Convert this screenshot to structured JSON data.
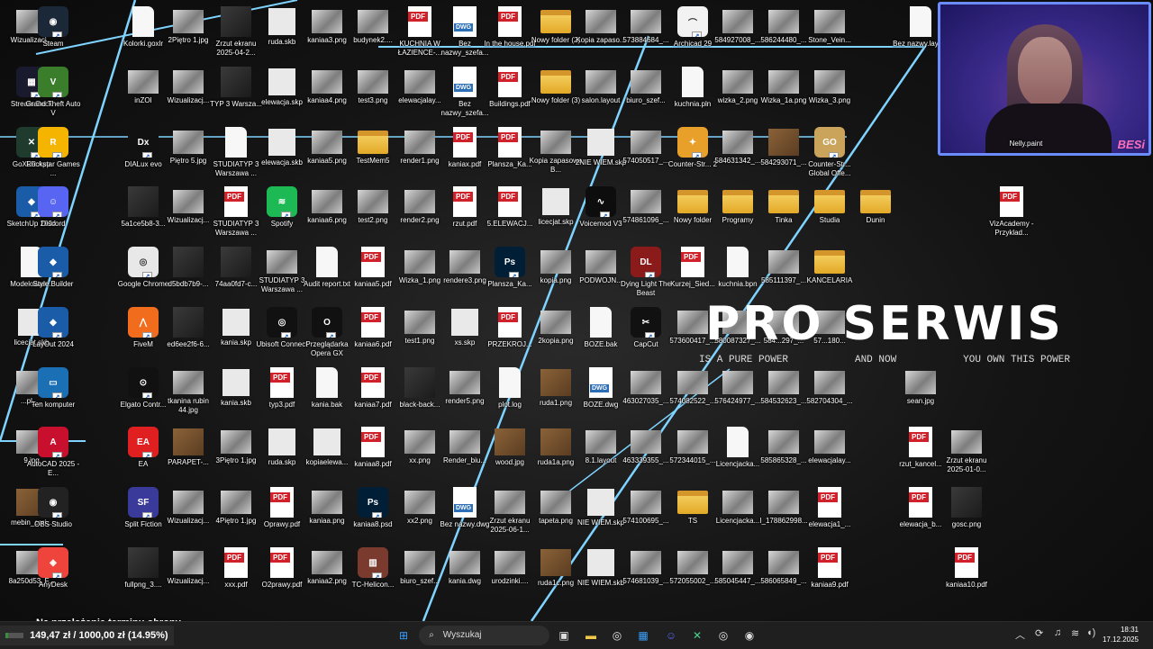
{
  "desktop": {
    "icons": [
      {
        "label": "Wizualizacj...",
        "kind": "img"
      },
      {
        "label": "Steam",
        "kind": "app",
        "color": "#1b2838",
        "glyph": "◉"
      },
      {
        "label": "Kolorki.goxlr",
        "kind": "doc"
      },
      {
        "label": "2Piętro 1.jpg",
        "kind": "img"
      },
      {
        "label": "Zrzut ekranu 2025-04-2...",
        "kind": "dark"
      },
      {
        "label": "ruda.skb",
        "kind": "sketch"
      },
      {
        "label": "kaniaa3.png",
        "kind": "img"
      },
      {
        "label": "budynek2....",
        "kind": "img"
      },
      {
        "label": "KUCHNIA W ŁAZIENCE-...",
        "kind": "pdf"
      },
      {
        "label": "Bez nazwy_szefa...",
        "kind": "dwg"
      },
      {
        "label": "In the house.pdf",
        "kind": "pdf"
      },
      {
        "label": "Nowy folder (2)",
        "kind": "folder"
      },
      {
        "label": "Kopia zapaso...",
        "kind": "img"
      },
      {
        "label": "573884684_...",
        "kind": "img"
      },
      {
        "label": "Archicad 29",
        "kind": "app",
        "color": "#f2f2f2",
        "glyph": "⌒"
      },
      {
        "label": "584927008_...",
        "kind": "img"
      },
      {
        "label": "586244480_...",
        "kind": "img"
      },
      {
        "label": "Stone_Vein...",
        "kind": "img"
      },
      {
        "label": "Bez nazwy.layout",
        "kind": "doc"
      },
      {
        "label": "Stream Deck",
        "kind": "app",
        "color": "#1a1a2e",
        "glyph": "▦"
      },
      {
        "label": "Grand Theft Auto V",
        "kind": "app",
        "color": "#3a7d2a",
        "glyph": "V"
      },
      {
        "label": "inZOI",
        "kind": "img"
      },
      {
        "label": "Wizualizacj...",
        "kind": "img"
      },
      {
        "label": "TYP 3 Warsza...",
        "kind": "dark"
      },
      {
        "label": "elewacja.skp",
        "kind": "sketch"
      },
      {
        "label": "kaniaa4.png",
        "kind": "img"
      },
      {
        "label": "test3.png",
        "kind": "img"
      },
      {
        "label": "elewacjalay...",
        "kind": "img"
      },
      {
        "label": "Bez nazwy_szefa...",
        "kind": "dwg"
      },
      {
        "label": "Buildings.pdf",
        "kind": "pdf"
      },
      {
        "label": "Nowy folder (3)",
        "kind": "folder"
      },
      {
        "label": "salon.layout",
        "kind": "img"
      },
      {
        "label": "biuro_szef...",
        "kind": "img"
      },
      {
        "label": "kuchnia.pln",
        "kind": "doc"
      },
      {
        "label": "wizka_2.png",
        "kind": "img"
      },
      {
        "label": "Wizka_1a.png",
        "kind": "img"
      },
      {
        "label": "Wizka_3.png",
        "kind": "img"
      },
      {
        "label": "GoXLR App",
        "kind": "app",
        "color": "#1f3b2e",
        "glyph": "✕"
      },
      {
        "label": "Rockstar Games ...",
        "kind": "app",
        "color": "#f5b400",
        "glyph": "R"
      },
      {
        "label": "DIALux evo",
        "kind": "app",
        "color": "#111",
        "glyph": "Dx"
      },
      {
        "label": "Piętro 5.jpg",
        "kind": "img"
      },
      {
        "label": "STUDIATYP 3 Warszawa ...",
        "kind": "doc"
      },
      {
        "label": "elewacja.skb",
        "kind": "sketch"
      },
      {
        "label": "kaniaa5.png",
        "kind": "img"
      },
      {
        "label": "TestMem5",
        "kind": "folder"
      },
      {
        "label": "render1.png",
        "kind": "img"
      },
      {
        "label": "kaniax.pdf",
        "kind": "pdf"
      },
      {
        "label": "Plansza_Ka...",
        "kind": "pdf"
      },
      {
        "label": "Kopia zapasowa B...",
        "kind": "img"
      },
      {
        "label": "2NIE WIEM.skp",
        "kind": "sketch"
      },
      {
        "label": "574050517_...",
        "kind": "img"
      },
      {
        "label": "Counter-Str... 2",
        "kind": "app",
        "color": "#e8a02a",
        "glyph": "✦"
      },
      {
        "label": "584631342_...",
        "kind": "img"
      },
      {
        "label": "584293071_...",
        "kind": "wood"
      },
      {
        "label": "Counter-Str... Global Offe...",
        "kind": "app",
        "color": "#c9a45a",
        "glyph": "GO"
      },
      {
        "label": "SketchUp 2024",
        "kind": "app",
        "color": "#1a5ca8",
        "glyph": "◆"
      },
      {
        "label": "Discord",
        "kind": "app",
        "color": "#5865f2",
        "glyph": "☺"
      },
      {
        "label": "5a1ce5b8-3...",
        "kind": "dark"
      },
      {
        "label": "Wizualizacj...",
        "kind": "img"
      },
      {
        "label": "STUDIATYP 3 Warszawa ...",
        "kind": "pdf"
      },
      {
        "label": "Spotify",
        "kind": "app",
        "color": "#1db954",
        "glyph": "≋"
      },
      {
        "label": "kaniaa6.png",
        "kind": "img"
      },
      {
        "label": "test2.png",
        "kind": "img"
      },
      {
        "label": "render2.png",
        "kind": "img"
      },
      {
        "label": "rzut.pdf",
        "kind": "pdf"
      },
      {
        "label": "5.ELEWACJ...",
        "kind": "pdf"
      },
      {
        "label": "licecjat.skp",
        "kind": "sketch"
      },
      {
        "label": "Voicemod V3",
        "kind": "app",
        "color": "#0d0d0d",
        "glyph": "∿"
      },
      {
        "label": "574861096_...",
        "kind": "img"
      },
      {
        "label": "Nowy folder",
        "kind": "folder"
      },
      {
        "label": "Programy",
        "kind": "folder"
      },
      {
        "label": "Tinka",
        "kind": "folder"
      },
      {
        "label": "Studia",
        "kind": "folder"
      },
      {
        "label": "Dunin",
        "kind": "folder"
      },
      {
        "label": "VizAcademy - Przyklad...",
        "kind": "pdf"
      },
      {
        "label": "Modelowan...",
        "kind": "doc"
      },
      {
        "label": "Style Builder",
        "kind": "app",
        "color": "#1a5ca8",
        "glyph": "◆"
      },
      {
        "label": "Google Chrome",
        "kind": "app",
        "color": "#e8e8e8",
        "glyph": "◎"
      },
      {
        "label": "d5bdb7b9-...",
        "kind": "dark"
      },
      {
        "label": "74aa0fd7-c...",
        "kind": "dark"
      },
      {
        "label": "STUDIATYP 3 Warszawa ...",
        "kind": "img"
      },
      {
        "label": "Audit report.txt",
        "kind": "doc"
      },
      {
        "label": "kaniaa5.pdf",
        "kind": "pdf"
      },
      {
        "label": "Wizka_1.png",
        "kind": "img"
      },
      {
        "label": "rendere3.png",
        "kind": "img"
      },
      {
        "label": "Plansza_Ka...",
        "kind": "app",
        "color": "#001e36",
        "glyph": "Ps"
      },
      {
        "label": "kopia.png",
        "kind": "img"
      },
      {
        "label": "PODWOJN...",
        "kind": "img"
      },
      {
        "label": "Dying Light The Beast",
        "kind": "app",
        "color": "#8b1a1a",
        "glyph": "DL"
      },
      {
        "label": "Kurzej_Sied...",
        "kind": "pdf"
      },
      {
        "label": "kuchnia.bpn",
        "kind": "doc"
      },
      {
        "label": "585111397_...",
        "kind": "img"
      },
      {
        "label": "KANCELARIA",
        "kind": "folder"
      },
      {
        "label": "licecjat.skb",
        "kind": "sketch"
      },
      {
        "label": "LayOut 2024",
        "kind": "app",
        "color": "#1a5ca8",
        "glyph": "◆"
      },
      {
        "label": "FiveM",
        "kind": "app",
        "color": "#f26c1d",
        "glyph": "⋀"
      },
      {
        "label": "ed6ee2f6-6...",
        "kind": "dark"
      },
      {
        "label": "kania.skp",
        "kind": "sketch"
      },
      {
        "label": "Ubisoft Connect",
        "kind": "app",
        "color": "#111",
        "glyph": "◎"
      },
      {
        "label": "Przeglądarka Opera GX",
        "kind": "app",
        "color": "#111",
        "glyph": "O"
      },
      {
        "label": "kaniaa6.pdf",
        "kind": "pdf"
      },
      {
        "label": "test1.png",
        "kind": "img"
      },
      {
        "label": "xs.skp",
        "kind": "sketch"
      },
      {
        "label": "PRZEKROJ...",
        "kind": "pdf"
      },
      {
        "label": "2kopia.png",
        "kind": "img"
      },
      {
        "label": "BOZE.bak",
        "kind": "doc"
      },
      {
        "label": "CapCut",
        "kind": "app",
        "color": "#111",
        "glyph": "✂"
      },
      {
        "label": "573600417_...",
        "kind": "img"
      },
      {
        "label": "580087327_...",
        "kind": "img"
      },
      {
        "label": "584...297_...",
        "kind": "img"
      },
      {
        "label": "57...180...",
        "kind": "img"
      },
      {
        "label": "...pl_...",
        "kind": "img"
      },
      {
        "label": "Ten komputer",
        "kind": "app",
        "color": "#1b6fb5",
        "glyph": "▭"
      },
      {
        "label": "Elgato Contr...",
        "kind": "app",
        "color": "#111",
        "glyph": "⊙"
      },
      {
        "label": "tkanina rubin 44.jpg",
        "kind": "img"
      },
      {
        "label": "kania.skb",
        "kind": "sketch"
      },
      {
        "label": "typ3.pdf",
        "kind": "pdf"
      },
      {
        "label": "kania.bak",
        "kind": "doc"
      },
      {
        "label": "kaniaa7.pdf",
        "kind": "pdf"
      },
      {
        "label": "black-back...",
        "kind": "dark"
      },
      {
        "label": "render5.png",
        "kind": "img"
      },
      {
        "label": "plot.log",
        "kind": "doc"
      },
      {
        "label": "ruda1.png",
        "kind": "wood"
      },
      {
        "label": "BOZE.dwg",
        "kind": "dwg"
      },
      {
        "label": "463027035_...",
        "kind": "img"
      },
      {
        "label": "574082522_...",
        "kind": "img"
      },
      {
        "label": "576424977_...",
        "kind": "img"
      },
      {
        "label": "584532623_...",
        "kind": "img"
      },
      {
        "label": "582704304_...",
        "kind": "img"
      },
      {
        "label": "sean.jpg",
        "kind": "img"
      },
      {
        "label": "9.jpg",
        "kind": "img"
      },
      {
        "label": "AutoCAD 2025 - E...",
        "kind": "app",
        "color": "#c8102e",
        "glyph": "A"
      },
      {
        "label": "EA",
        "kind": "app",
        "color": "#e02020",
        "glyph": "EA"
      },
      {
        "label": "PARAPET-...",
        "kind": "wood"
      },
      {
        "label": "3Piętro 1.jpg",
        "kind": "img"
      },
      {
        "label": "ruda.skp",
        "kind": "sketch"
      },
      {
        "label": "kopiaelewa...",
        "kind": "sketch"
      },
      {
        "label": "kaniaa8.pdf",
        "kind": "pdf"
      },
      {
        "label": "xx.png",
        "kind": "img"
      },
      {
        "label": "Render_biu...",
        "kind": "img"
      },
      {
        "label": "wood.jpg",
        "kind": "wood"
      },
      {
        "label": "ruda1a.png",
        "kind": "wood"
      },
      {
        "label": "8.1.layout",
        "kind": "img"
      },
      {
        "label": "463339355_...",
        "kind": "img"
      },
      {
        "label": "572344015_...",
        "kind": "img"
      },
      {
        "label": "Licencjacka...",
        "kind": "doc"
      },
      {
        "label": "585865328_...",
        "kind": "img"
      },
      {
        "label": "elewacjalay...",
        "kind": "img"
      },
      {
        "label": "rzut_kancel...",
        "kind": "pdf"
      },
      {
        "label": "Zrzut ekranu 2025-01-0...",
        "kind": "img"
      },
      {
        "label": "mebin_cori...",
        "kind": "wood"
      },
      {
        "label": "OBS Studio",
        "kind": "app",
        "color": "#222",
        "glyph": "◉"
      },
      {
        "label": "Split Fiction",
        "kind": "app",
        "color": "#3a3a9a",
        "glyph": "SF"
      },
      {
        "label": "Wizualizacj...",
        "kind": "img"
      },
      {
        "label": "4Piętro 1.jpg",
        "kind": "img"
      },
      {
        "label": "Oprawy.pdf",
        "kind": "pdf"
      },
      {
        "label": "kaniaa.png",
        "kind": "img"
      },
      {
        "label": "kaniaa8.psd",
        "kind": "app",
        "color": "#001e36",
        "glyph": "Ps"
      },
      {
        "label": "xx2.png",
        "kind": "img"
      },
      {
        "label": "Bez nazwy.dwg",
        "kind": "dwg"
      },
      {
        "label": "Zrzut ekranu 2025-06-1...",
        "kind": "img"
      },
      {
        "label": "tapeta.png",
        "kind": "img"
      },
      {
        "label": "NIE WIEM.skp",
        "kind": "sketch"
      },
      {
        "label": "574100695_...",
        "kind": "img"
      },
      {
        "label": "TS",
        "kind": "folder"
      },
      {
        "label": "Licencjacka...",
        "kind": "img"
      },
      {
        "label": "I_178862998...",
        "kind": "img"
      },
      {
        "label": "elewacja1_...",
        "kind": "pdf"
      },
      {
        "label": "elewacja_b...",
        "kind": "pdf"
      },
      {
        "label": "gosc.png",
        "kind": "dark"
      },
      {
        "label": "8a250d53_F...",
        "kind": "img"
      },
      {
        "label": "AnyDesk",
        "kind": "app",
        "color": "#ef443b",
        "glyph": "◈"
      },
      {
        "label": "fullpng_3....",
        "kind": "dark"
      },
      {
        "label": "Wizualizacj...",
        "kind": "img"
      },
      {
        "label": "xxx.pdf",
        "kind": "pdf"
      },
      {
        "label": "O2prawy.pdf",
        "kind": "pdf"
      },
      {
        "label": "kaniaa2.png",
        "kind": "img"
      },
      {
        "label": "TC-Helicon...",
        "kind": "app",
        "color": "#7a3b2e",
        "glyph": "▥"
      },
      {
        "label": "biuro_szef...",
        "kind": "img"
      },
      {
        "label": "kania.dwg",
        "kind": "img"
      },
      {
        "label": "urodzinki....",
        "kind": "img"
      },
      {
        "label": "ruda1c.png",
        "kind": "wood"
      },
      {
        "label": "NIE WIEM.skb",
        "kind": "sketch"
      },
      {
        "label": "574681039_...",
        "kind": "img"
      },
      {
        "label": "572055002_...",
        "kind": "img"
      },
      {
        "label": "585045447_...",
        "kind": "img"
      },
      {
        "label": "586065849_...",
        "kind": "img"
      },
      {
        "label": "kaniaa9.pdf",
        "kind": "pdf"
      },
      {
        "label": "kaniaa10.pdf",
        "kind": "pdf"
      },
      {
        "label": "ko0ipa.jpg",
        "kind": "img"
      }
    ],
    "webcam": {
      "tag": "BESi",
      "label": "Nelly.paint"
    }
  },
  "banner": {
    "title": "PRO SERWIS",
    "sub1": "IS A PURE POWER",
    "sub2": "AND NOW",
    "sub3": "YOU OWN THIS POWER"
  },
  "notification": "Na przełożenie terminu obrony",
  "taskbar": {
    "budget": "149,47 zł / 1000,00 zł (14.95%)",
    "budget_fraction": 0.1495,
    "search_placeholder": "Wyszukaj",
    "time": "18:31",
    "date": "17.12.2025",
    "apps": [
      {
        "name": "start",
        "glyph": "⊞",
        "color": "#3aa0ff"
      },
      {
        "name": "task-view",
        "glyph": "▣",
        "color": "#ddd"
      },
      {
        "name": "file-explorer",
        "glyph": "▬",
        "color": "#f2c84b"
      },
      {
        "name": "chrome",
        "glyph": "◎",
        "color": "#e8e8e8"
      },
      {
        "name": "store",
        "glyph": "▦",
        "color": "#3aa0ff"
      },
      {
        "name": "discord",
        "glyph": "☺",
        "color": "#5865f2"
      },
      {
        "name": "goxlr",
        "glyph": "✕",
        "color": "#4bd18b"
      },
      {
        "name": "chrome-2",
        "glyph": "◎",
        "color": "#e8e8e8"
      },
      {
        "name": "obs",
        "glyph": "◉",
        "color": "#ddd"
      }
    ]
  }
}
